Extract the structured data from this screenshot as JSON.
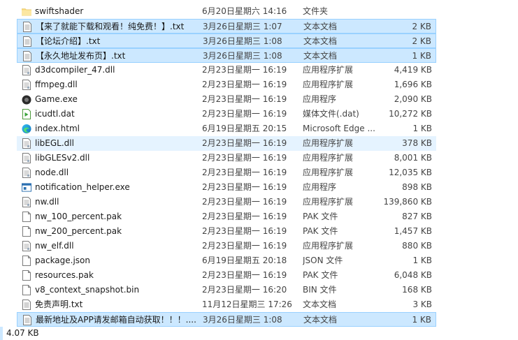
{
  "files": [
    {
      "name": "swiftshader",
      "date": "6月20日星期六 14:16",
      "type": "文件夹",
      "size": "",
      "icon": "folder-icon",
      "state": "normal"
    },
    {
      "name": "【来了就能下载和观看！纯免费！】.txt",
      "date": "3月26日星期三 1:07",
      "type": "文本文档",
      "size": "2 KB",
      "icon": "text-file-icon",
      "state": "selected"
    },
    {
      "name": "【论坛介绍】.txt",
      "date": "3月26日星期三 1:08",
      "type": "文本文档",
      "size": "2 KB",
      "icon": "text-file-icon",
      "state": "selected"
    },
    {
      "name": "【永久地址发布页】.txt",
      "date": "3月26日星期三 1:08",
      "type": "文本文档",
      "size": "1 KB",
      "icon": "text-file-icon",
      "state": "selected"
    },
    {
      "name": "d3dcompiler_47.dll",
      "date": "2月23日星期一 16:19",
      "type": "应用程序扩展",
      "size": "4,419 KB",
      "icon": "dll-file-icon",
      "state": "normal"
    },
    {
      "name": "ffmpeg.dll",
      "date": "2月23日星期一 16:19",
      "type": "应用程序扩展",
      "size": "1,696 KB",
      "icon": "dll-file-icon",
      "state": "normal"
    },
    {
      "name": "Game.exe",
      "date": "2月23日星期一 16:19",
      "type": "应用程序",
      "size": "2,090 KB",
      "icon": "game-exe-icon",
      "state": "normal"
    },
    {
      "name": "icudtl.dat",
      "date": "2月23日星期一 16:19",
      "type": "媒体文件(.dat)",
      "size": "10,272 KB",
      "icon": "media-file-icon",
      "state": "normal"
    },
    {
      "name": "index.html",
      "date": "6月19日星期五 20:15",
      "type": "Microsoft Edge ...",
      "size": "1 KB",
      "icon": "edge-html-icon",
      "state": "normal"
    },
    {
      "name": "libEGL.dll",
      "date": "2月23日星期一 16:19",
      "type": "应用程序扩展",
      "size": "378 KB",
      "icon": "dll-file-icon",
      "state": "hover"
    },
    {
      "name": "libGLESv2.dll",
      "date": "2月23日星期一 16:19",
      "type": "应用程序扩展",
      "size": "8,001 KB",
      "icon": "dll-file-icon",
      "state": "normal"
    },
    {
      "name": "node.dll",
      "date": "2月23日星期一 16:19",
      "type": "应用程序扩展",
      "size": "12,035 KB",
      "icon": "dll-file-icon",
      "state": "normal"
    },
    {
      "name": "notification_helper.exe",
      "date": "2月23日星期一 16:19",
      "type": "应用程序",
      "size": "898 KB",
      "icon": "exe-window-icon",
      "state": "normal"
    },
    {
      "name": "nw.dll",
      "date": "2月23日星期一 16:19",
      "type": "应用程序扩展",
      "size": "139,860 KB",
      "icon": "dll-file-icon",
      "state": "normal"
    },
    {
      "name": "nw_100_percent.pak",
      "date": "2月23日星期一 16:19",
      "type": "PAK 文件",
      "size": "827 KB",
      "icon": "blank-file-icon",
      "state": "normal"
    },
    {
      "name": "nw_200_percent.pak",
      "date": "2月23日星期一 16:19",
      "type": "PAK 文件",
      "size": "1,457 KB",
      "icon": "blank-file-icon",
      "state": "normal"
    },
    {
      "name": "nw_elf.dll",
      "date": "2月23日星期一 16:19",
      "type": "应用程序扩展",
      "size": "880 KB",
      "icon": "dll-file-icon",
      "state": "normal"
    },
    {
      "name": "package.json",
      "date": "6月19日星期五 20:18",
      "type": "JSON 文件",
      "size": "1 KB",
      "icon": "blank-file-icon",
      "state": "normal"
    },
    {
      "name": "resources.pak",
      "date": "2月23日星期一 16:19",
      "type": "PAK 文件",
      "size": "6,048 KB",
      "icon": "blank-file-icon",
      "state": "normal"
    },
    {
      "name": "v8_context_snapshot.bin",
      "date": "2月23日星期一 16:20",
      "type": "BIN 文件",
      "size": "168 KB",
      "icon": "blank-file-icon",
      "state": "normal"
    },
    {
      "name": "免责声明.txt",
      "date": "11月12日星期三 17:26",
      "type": "文本文档",
      "size": "3 KB",
      "icon": "text-file-icon",
      "state": "normal"
    },
    {
      "name": "最新地址及APP请发邮箱自动获取！！！....",
      "date": "3月26日星期三 1:08",
      "type": "文本文档",
      "size": "1 KB",
      "icon": "text-file-icon",
      "state": "selected"
    }
  ],
  "status_bar": {
    "selection_size": "4.07 KB"
  },
  "colors": {
    "selected_bg": "#cce8ff",
    "selected_border": "#99d1ff",
    "hover_bg": "#e5f3ff",
    "folder": "#f8d775"
  }
}
